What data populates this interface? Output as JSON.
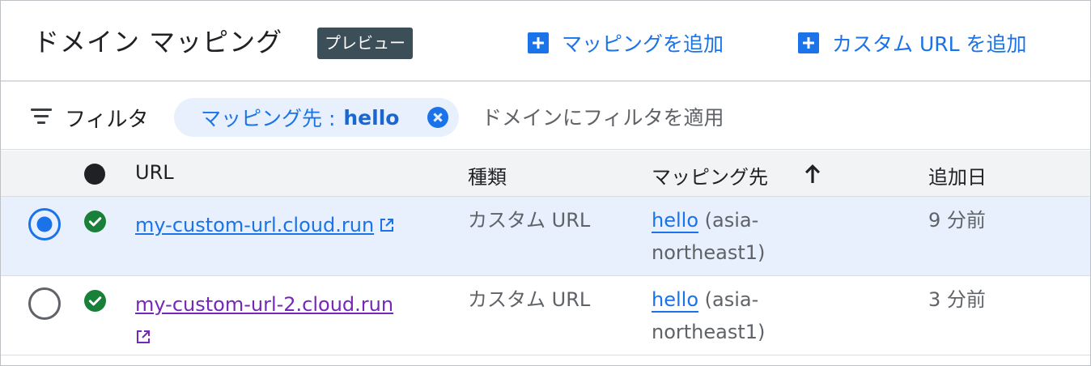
{
  "header": {
    "title": "ドメイン マッピング",
    "badge": "プレビュー",
    "add_mapping_label": "マッピングを追加",
    "add_custom_url_label": "カスタム URL を追加"
  },
  "filter": {
    "label": "フィルタ",
    "chip_label": "マッピング先 :",
    "chip_value": "hello",
    "input_placeholder": "ドメインにフィルタを適用"
  },
  "table": {
    "columns": {
      "url": "URL",
      "type": "種類",
      "mapping": "マッピング先",
      "added": "追加日"
    },
    "sort": {
      "column": "mapping",
      "direction": "ascending"
    },
    "rows": [
      {
        "selected": true,
        "status": "ok",
        "url": "my-custom-url.cloud.run",
        "type": "カスタム URL",
        "mapping_service": "hello",
        "mapping_region": "(asia-northeast1)",
        "added": "9 分前"
      },
      {
        "selected": false,
        "status": "ok",
        "url": "my-custom-url-2.cloud.run",
        "type": "カスタム URL",
        "mapping_service": "hello",
        "mapping_region": "(asia-northeast1)",
        "added": "3 分前"
      }
    ]
  },
  "colors": {
    "accent": "#1a73e8",
    "badge_bg": "#3c4e57",
    "chip_bg": "#e8f0fe",
    "success": "#188038",
    "visited_link": "#7627bb",
    "header_row_bg": "#f1f3f4"
  },
  "icons": {
    "add": "plus-box-icon",
    "filter": "filter-list-icon",
    "chip_remove": "cancel-circle-icon",
    "status_header": "status-dot-icon",
    "sort": "arrow-up-icon",
    "status_ok": "check-circle-icon",
    "external": "open-in-new-icon"
  }
}
